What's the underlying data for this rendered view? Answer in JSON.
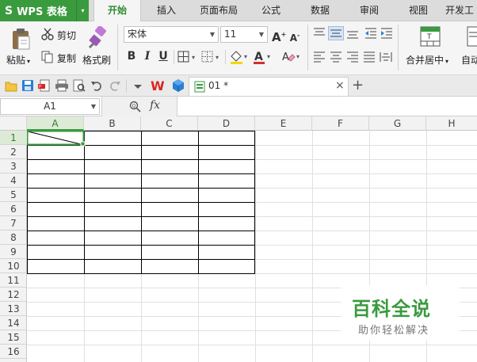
{
  "app": {
    "logo_letter": "S",
    "logo_title": "WPS 表格",
    "logo_caret": "▾"
  },
  "menu_tabs": [
    "开始",
    "插入",
    "页面布局",
    "公式",
    "数据",
    "审阅",
    "视图",
    "开发工"
  ],
  "ribbon": {
    "paste": "粘贴",
    "cut": "剪切",
    "copy": "复制",
    "format_painter": "格式刷",
    "font_name": "宋体",
    "font_size": "11",
    "bold": "B",
    "italic": "I",
    "underline": "U",
    "merge_center": "合并居中",
    "auto_wrap": "自动"
  },
  "colors": {
    "accent": "#3a9a3e",
    "font_color": "#d32f2f",
    "fill_color": "#f5d800",
    "wps_red": "#d9281f",
    "blue": "#2a7fd4"
  },
  "document": {
    "tab_title": "01 *",
    "close": "×",
    "new_tab": "+"
  },
  "formula_bar": {
    "name_box": "A1",
    "fx": "fx"
  },
  "columns": [
    "A",
    "B",
    "C",
    "D",
    "E",
    "F",
    "G",
    "H"
  ],
  "rows": [
    "1",
    "2",
    "3",
    "4",
    "5",
    "6",
    "7",
    "8",
    "9",
    "10",
    "11",
    "12",
    "13",
    "14",
    "15",
    "16"
  ],
  "selected_cell": "A1",
  "watermark": {
    "title": "百科全说",
    "subtitle": "助你轻松解决"
  }
}
